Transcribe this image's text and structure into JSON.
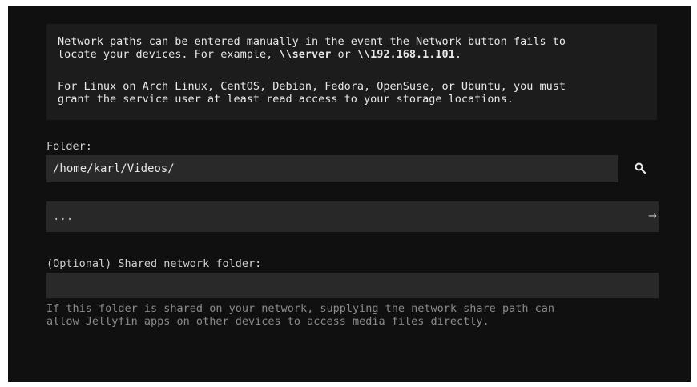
{
  "info": {
    "p1_line1": "Network paths can be entered manually in the event the Network button fails to",
    "p1_line2_pre": "locate your devices. For example, ",
    "p1_example1": "\\\\server",
    "p1_or": " or ",
    "p1_example2": "\\\\192.168.1.101",
    "p1_end": ".",
    "p2_line1": "For Linux on Arch Linux, CentOS, Debian, Fedora, OpenSuse, or Ubuntu, you must",
    "p2_line2": "grant the service user at least read access to your storage locations."
  },
  "folder": {
    "label": "Folder:",
    "value": "/home/karl/Videos/",
    "search_icon": "search-icon"
  },
  "path_row": {
    "text": "...",
    "arrow": "→"
  },
  "shared": {
    "label": "(Optional) Shared network folder:",
    "value": "",
    "help_line1": "If this folder is shared on your network, supplying the network share path can",
    "help_line2": "allow Jellyfin apps on other devices to access media files directly."
  },
  "colors": {
    "background": "#101010",
    "panel": "#1c1c1c",
    "input": "#292929",
    "text": "#e8e8e8",
    "muted": "#8a8a8a"
  }
}
